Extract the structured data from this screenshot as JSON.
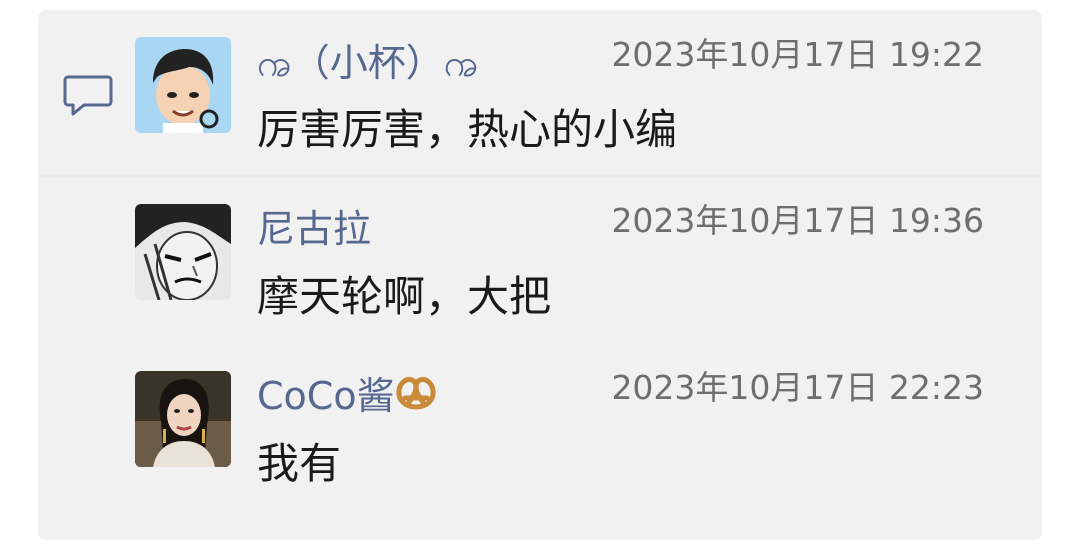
{
  "comments": [
    {
      "author": "ꩠ（小杯）ꩠ",
      "time": "2023年10月17日 19:22",
      "text": "厉害厉害，热心的小编",
      "avatar_icon": "cartoon-boy-avatar"
    },
    {
      "author": "尼古拉",
      "time": "2023年10月17日 19:36",
      "text": "摩天轮啊，大把",
      "avatar_icon": "manga-character-avatar"
    },
    {
      "author": "CoCo酱",
      "author_emoji": "pretzel-icon",
      "time": "2023年10月17日 22:23",
      "text": "我有",
      "avatar_icon": "woman-photo-avatar"
    }
  ],
  "colors": {
    "name": "#56688f",
    "time": "#6e6e6e",
    "text": "#1a1a1a",
    "panel": "#f1f1f1"
  }
}
